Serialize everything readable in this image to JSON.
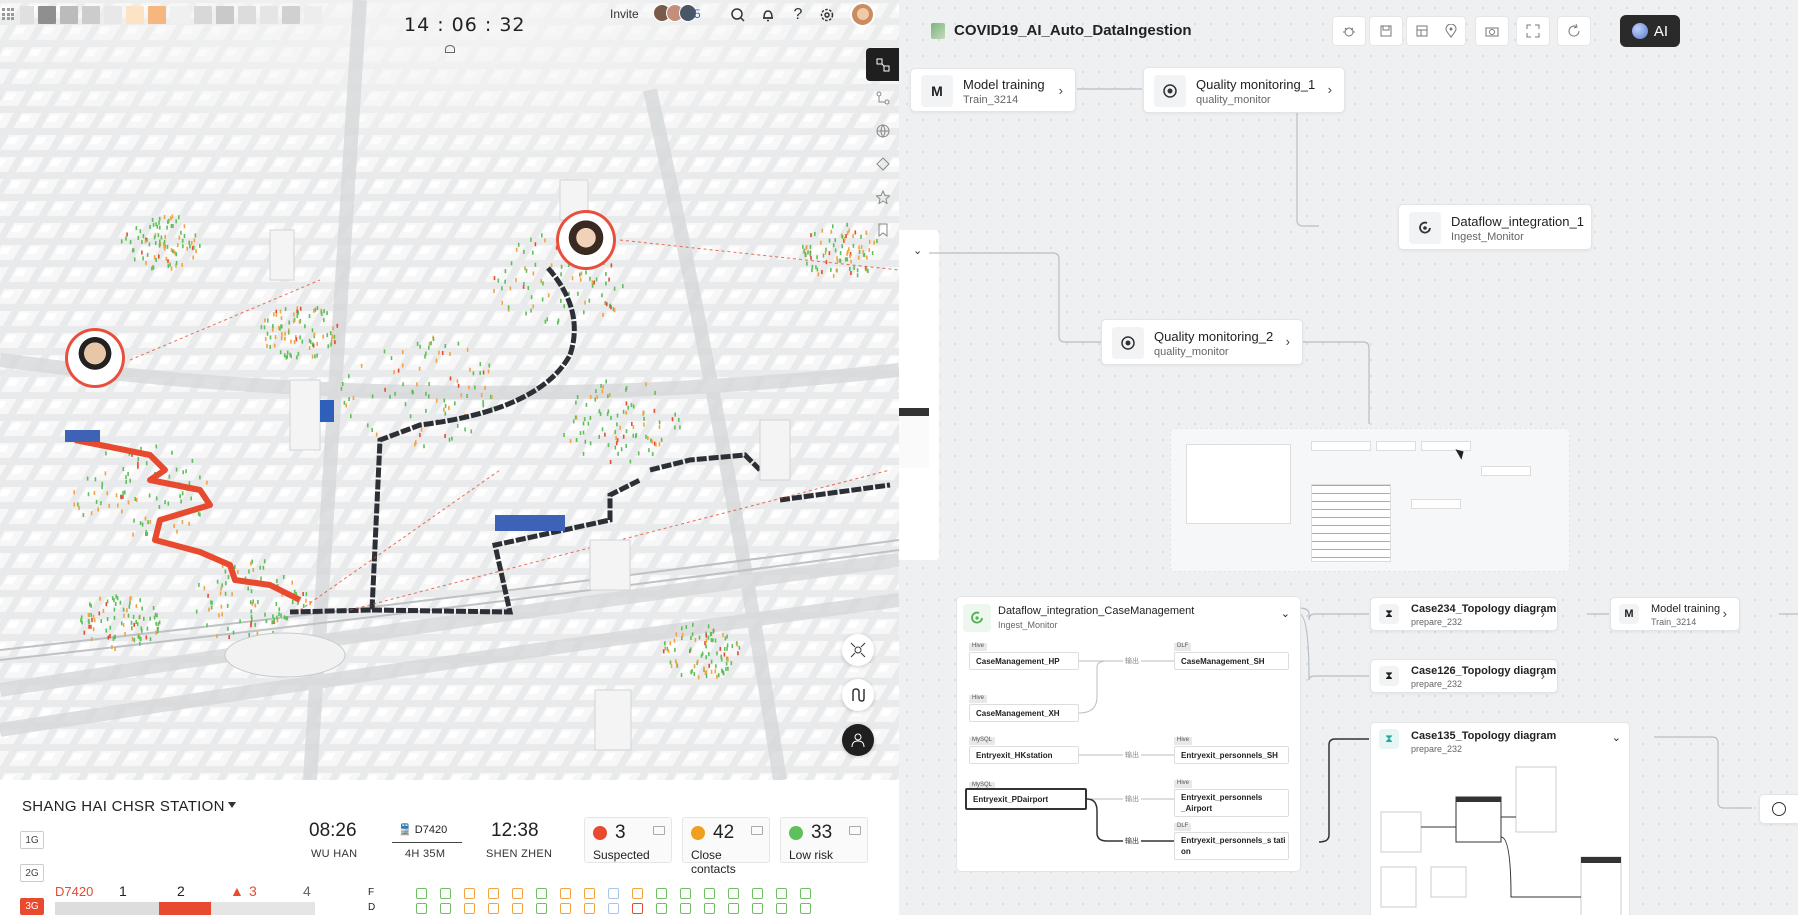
{
  "topbar": {
    "clock": "14 : 06 : 32",
    "invite_label": "Invite",
    "collaborator_count": "5"
  },
  "station": {
    "name": "SHANG HAI CHSR STATION",
    "depart_time": "08:26",
    "depart_city": "WU HAN",
    "train_no": "D7420",
    "duration": "4H 35M",
    "arrive_time": "12:38",
    "arrive_city": "SHEN ZHEN"
  },
  "stats": [
    {
      "count": "3",
      "label": "Suspected",
      "color": "#e84a2f"
    },
    {
      "count": "42",
      "label": "Close contacts",
      "color": "#f0a020"
    },
    {
      "count": "33",
      "label": "Low risk",
      "color": "#5fbf5a"
    }
  ],
  "grades": [
    "1G",
    "2G",
    "3G"
  ],
  "carriage": {
    "train": "D7420",
    "cars": [
      "1",
      "2",
      "3",
      "4"
    ],
    "alert_car": "3",
    "floors": [
      "F",
      "D"
    ]
  },
  "workflow": {
    "title": "COVID19_AI_Auto_DataIngestion",
    "ai_label": "AI",
    "nodes": {
      "model_training": {
        "title": "Model training",
        "sub": "Train_3214"
      },
      "quality1": {
        "title": "Quality monitoring_1",
        "sub": "quality_monitor"
      },
      "dataflow1": {
        "title": "Dataflow_integration_1",
        "sub": "Ingest_Monitor"
      },
      "quality2": {
        "title": "Quality monitoring_2",
        "sub": "quality_monitor"
      },
      "case_mgmt": {
        "title": "Dataflow_integration_CaseManagement",
        "sub": "Ingest_Monitor"
      },
      "case234": {
        "title": "Case234_Topology diagram",
        "sub": "prepare_232"
      },
      "model_training2": {
        "title": "Model training",
        "sub": "Train_3214"
      },
      "case126": {
        "title": "Case126_Topology diagram",
        "sub": "prepare_232"
      },
      "case135": {
        "title": "Case135_Topology diagram",
        "sub": "prepare_232"
      }
    },
    "subnodes": [
      {
        "name": "CaseManagement_HP",
        "tag": "Hive"
      },
      {
        "name": "CaseManagement_XH",
        "tag": "Hive"
      },
      {
        "name": "Entryexit_HKstation",
        "tag": "MySQL"
      },
      {
        "name": "Entryexit_PDairport",
        "tag": "MySQL"
      },
      {
        "name": "CaseManagement_SH",
        "tag": "DLF"
      },
      {
        "name": "Entryexit_personnels_SH",
        "tag": "Hive"
      },
      {
        "name": "Entryexit_personnels _Airport",
        "tag": "Hive"
      },
      {
        "name": "Entryexit_personnels_s tati on",
        "tag": "DLF"
      }
    ],
    "edge_label": "输出"
  }
}
